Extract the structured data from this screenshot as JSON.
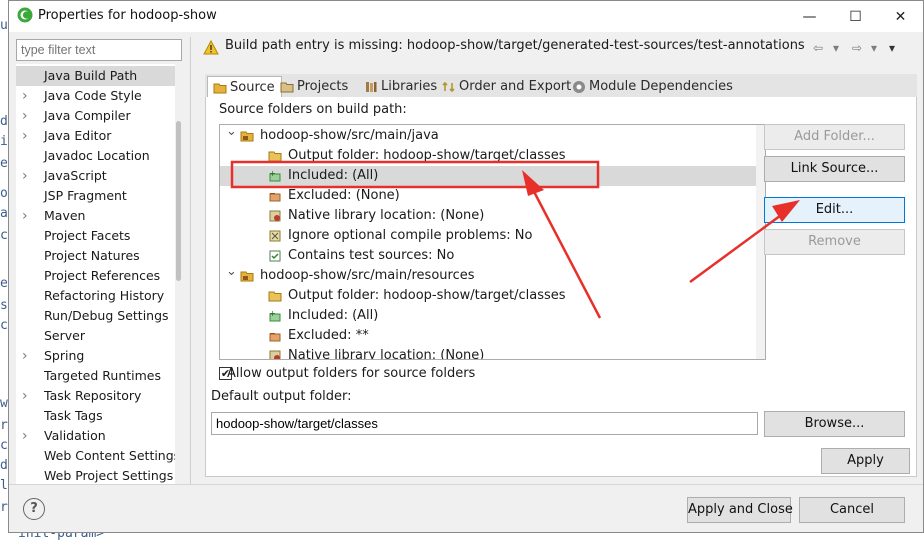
{
  "background": {
    "fragments": [
      "u",
      "d",
      "ie",
      "e",
      "oa",
      "a",
      "ce",
      "en",
      "si",
      "ce",
      "wa",
      "re",
      "c",
      "d",
      "le",
      "ru",
      "init-param>"
    ]
  },
  "window": {
    "title": "Properties for hodoop-show",
    "minimize": "—",
    "maximize": "☐",
    "close": "✕"
  },
  "left": {
    "filter_placeholder": "type filter text",
    "items": [
      {
        "label": "Java Build Path",
        "expandable": false,
        "selected": true
      },
      {
        "label": "Java Code Style",
        "expandable": true
      },
      {
        "label": "Java Compiler",
        "expandable": true
      },
      {
        "label": "Java Editor",
        "expandable": true
      },
      {
        "label": "Javadoc Location",
        "expandable": false
      },
      {
        "label": "JavaScript",
        "expandable": true
      },
      {
        "label": "JSP Fragment",
        "expandable": false
      },
      {
        "label": "Maven",
        "expandable": true
      },
      {
        "label": "Project Facets",
        "expandable": false
      },
      {
        "label": "Project Natures",
        "expandable": false
      },
      {
        "label": "Project References",
        "expandable": false
      },
      {
        "label": "Refactoring History",
        "expandable": false
      },
      {
        "label": "Run/Debug Settings",
        "expandable": false
      },
      {
        "label": "Server",
        "expandable": false
      },
      {
        "label": "Spring",
        "expandable": true
      },
      {
        "label": "Targeted Runtimes",
        "expandable": false
      },
      {
        "label": "Task Repository",
        "expandable": true
      },
      {
        "label": "Task Tags",
        "expandable": false
      },
      {
        "label": "Validation",
        "expandable": true
      },
      {
        "label": "Web Content Settings",
        "expandable": false
      },
      {
        "label": "Web Project Settings",
        "expandable": false
      }
    ]
  },
  "header": {
    "warning": "Build path entry is missing: hodoop-show/target/generated-test-sources/test-annotations",
    "nav_back": "⇦",
    "nav_fwd": "⇨",
    "nav_menu": "▾"
  },
  "tabs": [
    {
      "label": "Source",
      "icon": "source-tab-icon",
      "active": true
    },
    {
      "label": "Projects",
      "icon": "projects-tab-icon"
    },
    {
      "label": "Libraries",
      "icon": "libraries-tab-icon"
    },
    {
      "label": "Order and Export",
      "icon": "order-export-tab-icon"
    },
    {
      "label": "Module Dependencies",
      "icon": "module-dependencies-tab-icon"
    }
  ],
  "source": {
    "section_label": "Source folders on build path:",
    "rows": [
      {
        "text": "hodoop-show/src/main/java",
        "level": 0,
        "kind": "folder",
        "expanded": true
      },
      {
        "text": "Output folder: hodoop-show/target/classes",
        "level": 1,
        "kind": "output"
      },
      {
        "text": "Included: (All)",
        "level": 1,
        "kind": "included",
        "selected": true
      },
      {
        "text": "Excluded: (None)",
        "level": 1,
        "kind": "excluded"
      },
      {
        "text": "Native library location: (None)",
        "level": 1,
        "kind": "native"
      },
      {
        "text": "Ignore optional compile problems: No",
        "level": 1,
        "kind": "ignore"
      },
      {
        "text": "Contains test sources: No",
        "level": 1,
        "kind": "test"
      },
      {
        "text": "hodoop-show/src/main/resources",
        "level": 0,
        "kind": "folder",
        "expanded": true
      },
      {
        "text": "Output folder: hodoop-show/target/classes",
        "level": 1,
        "kind": "output"
      },
      {
        "text": "Included: (All)",
        "level": 1,
        "kind": "included"
      },
      {
        "text": "Excluded: **",
        "level": 1,
        "kind": "excluded"
      },
      {
        "text": "Native library location: (None)",
        "level": 1,
        "kind": "native"
      }
    ],
    "buttons": {
      "add_folder": "Add Folder...",
      "link_source": "Link Source...",
      "edit": "Edit...",
      "remove": "Remove"
    },
    "allow_output_label": "Allow output folders for source folders",
    "allow_output_checked": true,
    "default_output_label": "Default output folder:",
    "default_output_value": "hodoop-show/target/classes",
    "browse": "Browse..."
  },
  "footer": {
    "apply": "Apply",
    "apply_close": "Apply and Close",
    "cancel": "Cancel",
    "help": "?"
  },
  "colors": {
    "annotation": "#e8302b",
    "selection": "#d9d9d9",
    "focus_border": "#0078d7"
  }
}
